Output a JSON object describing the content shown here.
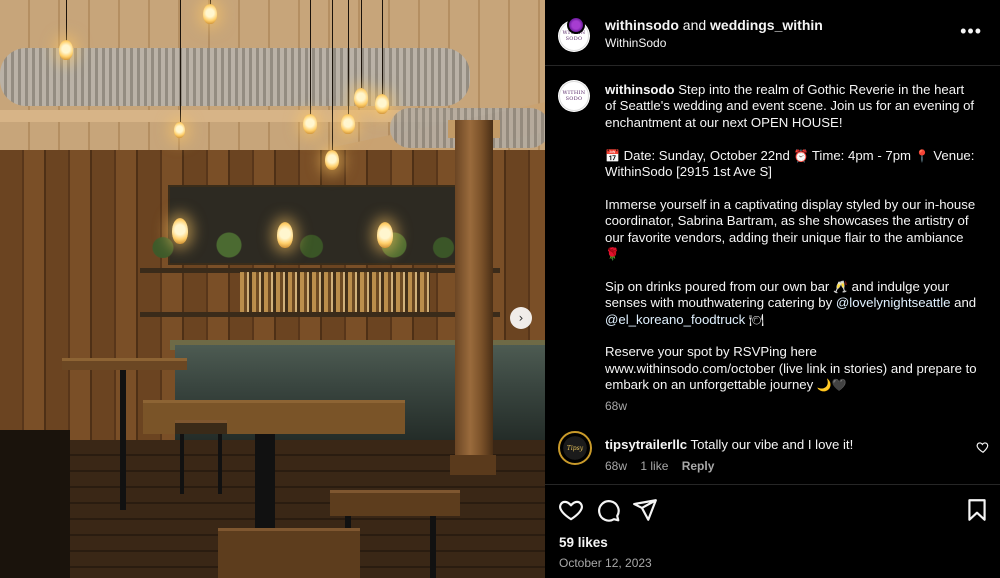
{
  "post": {
    "author_handle": "withinsodo",
    "and_text": "and",
    "collab_handle": "weddings_within",
    "subtitle": "WithinSodo",
    "avatar_monogram_top": "WITHIN",
    "avatar_monogram_bottom": "SODO",
    "more_label": "•••"
  },
  "caption": {
    "user": "withinsodo",
    "intro": "Step into the realm of Gothic Reverie in the heart of Seattle's wedding and event scene. Join us for an evening of enchantment at our next OPEN HOUSE!",
    "details_1": "Date: Sunday, October 22nd",
    "details_2": "Time: 4pm - 7pm",
    "details_3": "Venue: WithinSodo [2915 1st Ave S]",
    "para_immerse": "Immerse yourself in a captivating display styled by our in-house coordinator, Sabrina Bartram, as she showcases the artistry of our favorite vendors, adding their unique flair to the ambiance",
    "sip_1": "Sip on drinks poured from our own bar",
    "sip_2": "and indulge your senses with mouthwatering catering by",
    "mention_1": "@lovelynightseattle",
    "and_word": "and",
    "mention_2": "@el_koreano_foodtruck",
    "reserve": "Reserve your spot by RSVPing here www.withinsodo.com/october (live link in stories) and prepare to embark on an unforgettable journey",
    "time_ago": "68w"
  },
  "emojis": {
    "calendar": "📅",
    "clock": "⏰",
    "pin": "📍",
    "rose": "🌹",
    "glasses": "🥂",
    "plate": "🍽",
    "moon": "🌙",
    "black_heart": "🖤"
  },
  "comment": {
    "user": "tipsytrailerllc",
    "text": "Totally our vibe and I love it!",
    "time_ago": "68w",
    "likes": "1 like",
    "reply_label": "Reply",
    "avatar_text": "Tipsy"
  },
  "actions": {
    "likes": "59 likes",
    "date": "October 12, 2023"
  },
  "photo": {
    "next_arrow": "›"
  },
  "colors": {
    "background": "#000000",
    "text": "#f5f5f5",
    "muted": "#a8a8a8",
    "divider": "#262626",
    "mention": "#e0f1ff"
  }
}
